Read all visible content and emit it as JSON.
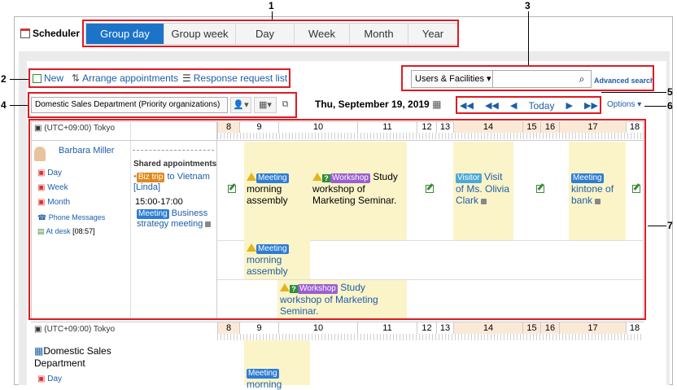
{
  "app": {
    "title": "Scheduler"
  },
  "view_tabs": [
    "Group day",
    "Group week",
    "Day",
    "Week",
    "Month",
    "Year"
  ],
  "active_view": "Group day",
  "toolbar": {
    "new": "New",
    "arrange": "Arrange appointments",
    "response": "Response request list"
  },
  "search": {
    "selector": "Users & Facilities",
    "placeholder": "",
    "advanced": "Advanced search"
  },
  "org_select": "Domestic Sales Department (Priority organizations)",
  "date": "Thu, September 19, 2019",
  "nav": {
    "today": "Today"
  },
  "options": "Options",
  "timezone": "(UTC+09:00) Tokyo",
  "hours": [
    "8",
    "9",
    "10",
    "11",
    "12",
    "13",
    "14",
    "15",
    "16",
    "17",
    "18"
  ],
  "user": {
    "name": "Barbara Miller",
    "links": [
      "Day",
      "Week",
      "Month",
      "Phone Messages"
    ],
    "status": "At desk",
    "status_time": "[08:57]"
  },
  "shared": {
    "heading": "Shared appointments",
    "biz_badge": "Biz trip",
    "biz_text": "to Vietnam [Linda]",
    "time": "15:00-17:00",
    "meeting_badge": "Meeting",
    "meeting_text": "Business strategy meeting"
  },
  "events": {
    "meeting1_badge": "Meeting",
    "meeting1_text": "morning assembly",
    "workshop_badge": "Workshop",
    "workshop_text1": "Study",
    "workshop_text2": "workshop of Marketing Seminar.",
    "visitor_badge": "Visitor",
    "visitor_text": "Visit of Ms. Olivia Clark",
    "meeting2_badge": "Meeting",
    "meeting2_text": "kintone of bank",
    "meeting3_badge": "Meeting",
    "meeting3_text": "morning assembly",
    "workshop2_badge": "Workshop",
    "workshop2_text": "Study workshop of Marketing Seminar."
  },
  "second_row": {
    "timezone": "(UTC+09:00) Tokyo",
    "org_name": "Domestic Sales Department",
    "link": "Day",
    "badge": "Meeting",
    "text": "morning"
  },
  "callouts": [
    "1",
    "2",
    "3",
    "4",
    "5",
    "6",
    "7"
  ]
}
